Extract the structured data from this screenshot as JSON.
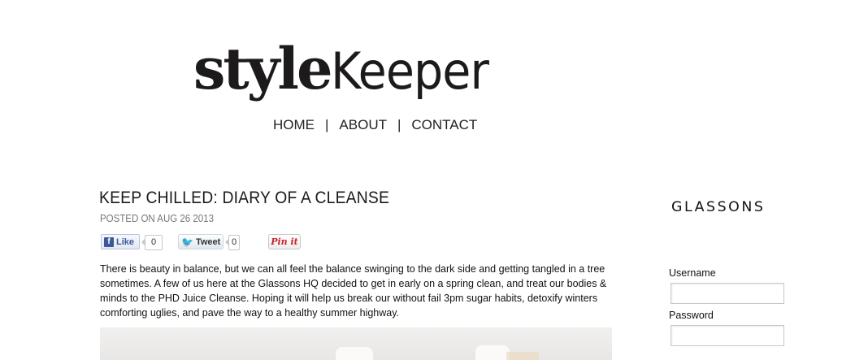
{
  "site": {
    "logo_bold": "style",
    "logo_light": "Keeper"
  },
  "nav": {
    "items": [
      "HOME",
      "ABOUT",
      "CONTACT"
    ],
    "separator": "|"
  },
  "post": {
    "title": "KEEP CHILLED: DIARY OF A CLEANSE",
    "date": "POSTED ON AUG 26 2013",
    "body": "There is beauty in balance, but we can all feel the balance swinging to the dark side and getting tangled in a tree sometimes. A few of us here at the Glassons HQ decided to get in early on a spring clean, and treat our bodies & minds to the PHD Juice Cleanse. Hoping it will help us break our without fail 3pm sugar habits, detoxify winters comforting uglies, and pave the way to a healthy summer highway."
  },
  "share": {
    "like_label": "Like",
    "like_count": "0",
    "tweet_label": "Tweet",
    "tweet_count": "0",
    "pin_label": "Pin it",
    "facebook_icon": "f",
    "twitter_icon": "bird-icon"
  },
  "sidebar": {
    "brand": "GLASSONS",
    "username_label": "Username",
    "password_label": "Password",
    "username_value": "",
    "password_value": ""
  },
  "colors": {
    "facebook": "#3b5998",
    "twitter": "#2ba9e1",
    "pinterest": "#c8232c",
    "date_gray": "#777777"
  }
}
